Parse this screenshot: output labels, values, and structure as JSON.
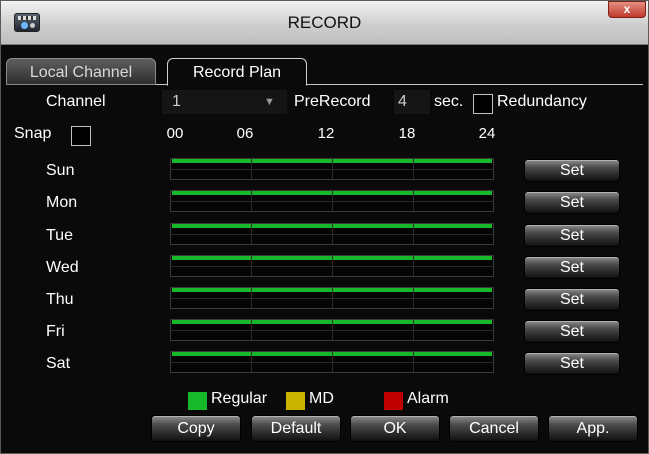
{
  "window": {
    "title": "RECORD",
    "close_label": "x",
    "icon": "record-app-icon"
  },
  "tabs": [
    {
      "label": "Local Channel",
      "active": false
    },
    {
      "label": "Record Plan",
      "active": true
    }
  ],
  "channel": {
    "label": "Channel",
    "value": "1"
  },
  "prerecord": {
    "label": "PreRecord",
    "value": "4",
    "unit": "sec."
  },
  "redundancy": {
    "label": "Redundancy",
    "checked": false
  },
  "snap": {
    "label": "Snap",
    "checked": false
  },
  "timeline_ticks": [
    "00",
    "06",
    "12",
    "18",
    "24"
  ],
  "days": [
    {
      "label": "Sun",
      "set_label": "Set"
    },
    {
      "label": "Mon",
      "set_label": "Set"
    },
    {
      "label": "Tue",
      "set_label": "Set"
    },
    {
      "label": "Wed",
      "set_label": "Set"
    },
    {
      "label": "Thu",
      "set_label": "Set"
    },
    {
      "label": "Fri",
      "set_label": "Set"
    },
    {
      "label": "Sat",
      "set_label": "Set"
    }
  ],
  "legend": [
    {
      "label": "Regular",
      "color": "#17b82a"
    },
    {
      "label": "MD",
      "color": "#c8b400"
    },
    {
      "label": "Alarm",
      "color": "#c00000"
    }
  ],
  "buttons": {
    "copy": "Copy",
    "default": "Default",
    "ok": "OK",
    "cancel": "Cancel",
    "apply": "App."
  }
}
